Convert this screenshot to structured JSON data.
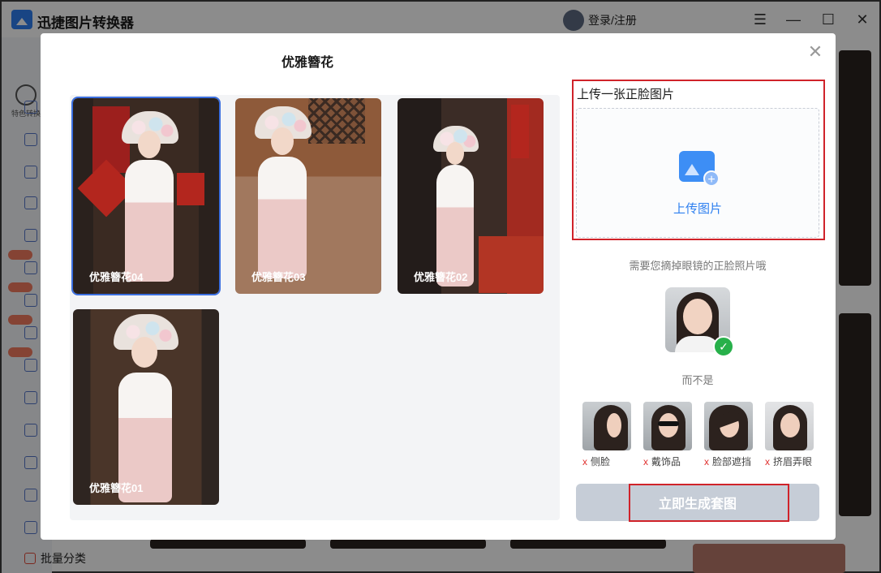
{
  "app": {
    "title": "迅捷图片转换器",
    "login_label": "登录/注册",
    "window_controls": {
      "menu": "☰",
      "minimize": "—",
      "maximize": "☐",
      "close": "✕"
    },
    "sidebar_feature_label": "特色转换",
    "sidebar_bottom_label": "批量分类"
  },
  "modal": {
    "title": "优雅簪花",
    "close_glyph": "✕",
    "templates": [
      {
        "label": "优雅簪花04",
        "selected": true
      },
      {
        "label": "优雅簪花03",
        "selected": false
      },
      {
        "label": "优雅簪花02",
        "selected": false
      },
      {
        "label": "优雅簪花01",
        "selected": false
      }
    ],
    "upload": {
      "heading": "上传一张正脸图片",
      "button_label": "上传图片",
      "icon": "image-upload-icon"
    },
    "hint": "需要您摘掉眼镜的正脸照片哦",
    "good_example_icon": "check-icon",
    "not_label": "而不是",
    "bad_examples": [
      {
        "mark": "x",
        "label": "侧脸"
      },
      {
        "mark": "x",
        "label": "戴饰品"
      },
      {
        "mark": "x",
        "label": "脸部遮挡"
      },
      {
        "mark": "x",
        "label": "挤眉弄眼"
      }
    ],
    "generate_label": "立即生成套图"
  },
  "colors": {
    "accent": "#2d7ff0",
    "selected_border": "#3b6fe0",
    "highlight_red": "#d0232a",
    "success_green": "#27b04a",
    "disabled_button": "#c6cdd7"
  }
}
